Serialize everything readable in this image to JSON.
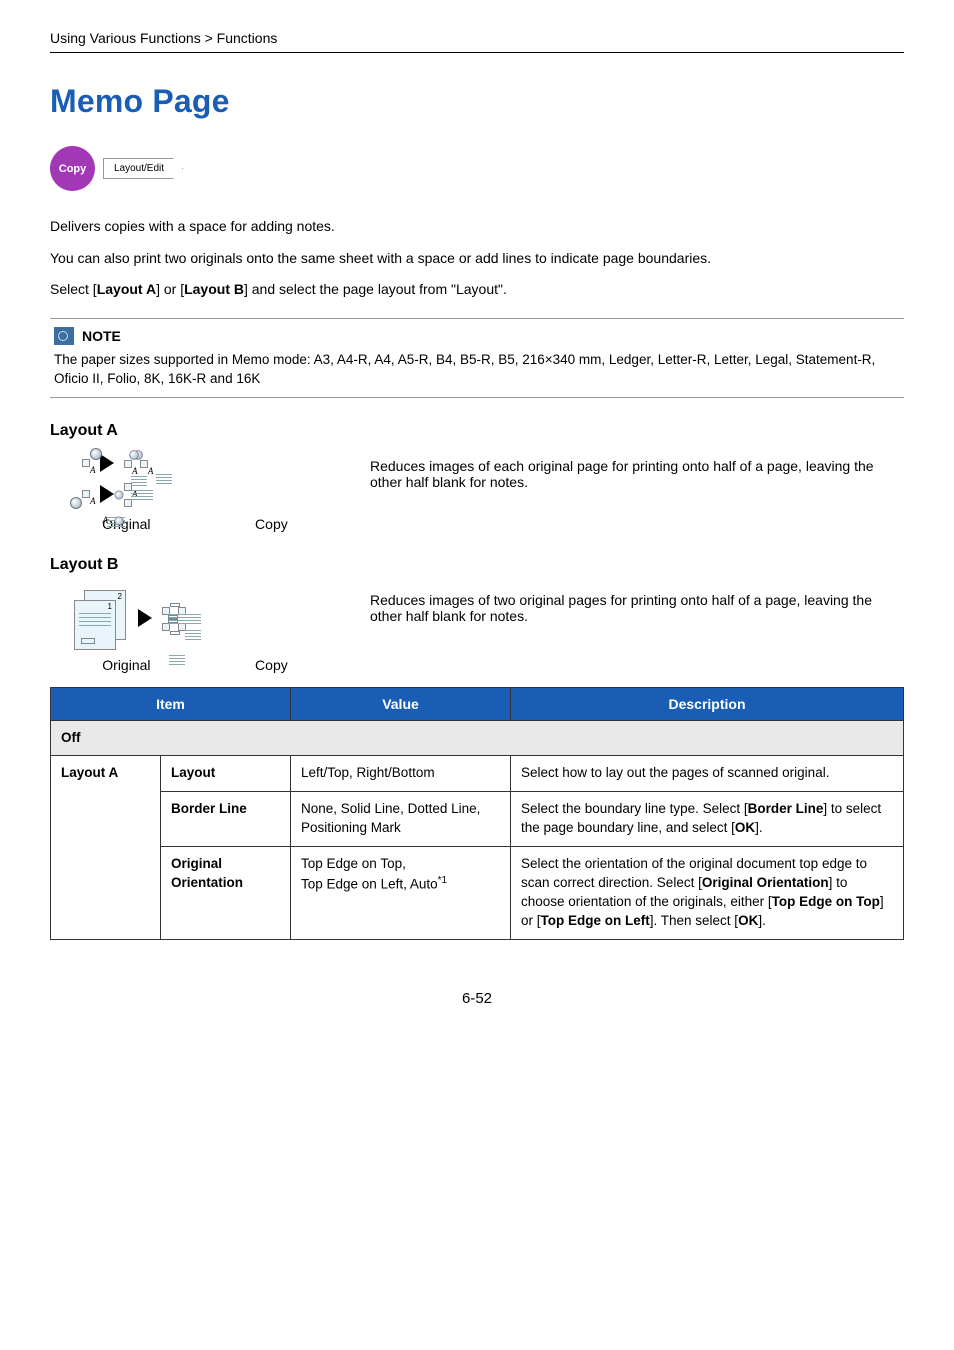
{
  "breadcrumb": "Using Various Functions > Functions",
  "title": "Memo Page",
  "badges": {
    "copy": "Copy",
    "layout": "Layout/Edit"
  },
  "intro": {
    "p1": "Delivers copies with a space for adding notes.",
    "p2": "You can also print two originals onto the same sheet with a space or add lines to indicate page boundaries.",
    "p3_pre": "Select [",
    "p3_b1": "Layout A",
    "p3_mid": "] or [",
    "p3_b2": "Layout B",
    "p3_post": "] and select the page layout from \"Layout\"."
  },
  "note": {
    "label": "NOTE",
    "body": "The paper sizes supported in Memo mode: A3, A4-R, A4, A5-R, B4, B5-R, B5, 216×340 mm, Ledger, Letter-R, Letter, Legal, Statement-R, Oficio II, Folio, 8K, 16K-R and 16K"
  },
  "layoutA": {
    "heading": "Layout A",
    "desc": "Reduces images of each original page for printing onto half of a page, leaving the other half blank for notes.",
    "label_original": "Original",
    "label_copy": "Copy",
    "letter": "A"
  },
  "layoutB": {
    "heading": "Layout B",
    "desc": "Reduces images of two original pages for printing onto half of a page, leaving the other half blank for notes.",
    "label_original": "Original",
    "label_copy": "Copy"
  },
  "table": {
    "headers": {
      "item": "Item",
      "value": "Value",
      "desc": "Description"
    },
    "off": "Off",
    "layoutA_label": "Layout A",
    "rows": [
      {
        "item": "Layout",
        "value": "Left/Top, Right/Bottom",
        "desc": "Select how to lay out the pages of scanned original."
      },
      {
        "item": "Border Line",
        "value": "None, Solid Line, Dotted Line, Positioning Mark",
        "desc_pre": "Select the boundary line type. Select [",
        "desc_b1": "Border Line",
        "desc_mid1": "] to select the page boundary line, and select [",
        "desc_b2": "OK",
        "desc_post": "]."
      },
      {
        "item": "Original Orientation",
        "value_l1": "Top Edge on Top,",
        "value_l2_pre": "Top Edge on Left, Auto",
        "value_sup": "*1",
        "desc_pre": "Select the orientation of the original document top edge to scan correct direction. Select [",
        "desc_b1": "Original Orientation",
        "desc_mid1": "] to choose orientation of the originals, either [",
        "desc_b2": "Top Edge on Top",
        "desc_mid2": "] or [",
        "desc_b3": "Top Edge on Left",
        "desc_mid3": "]. Then select [",
        "desc_b4": "OK",
        "desc_post": "]."
      }
    ]
  },
  "page_num": "6-52"
}
